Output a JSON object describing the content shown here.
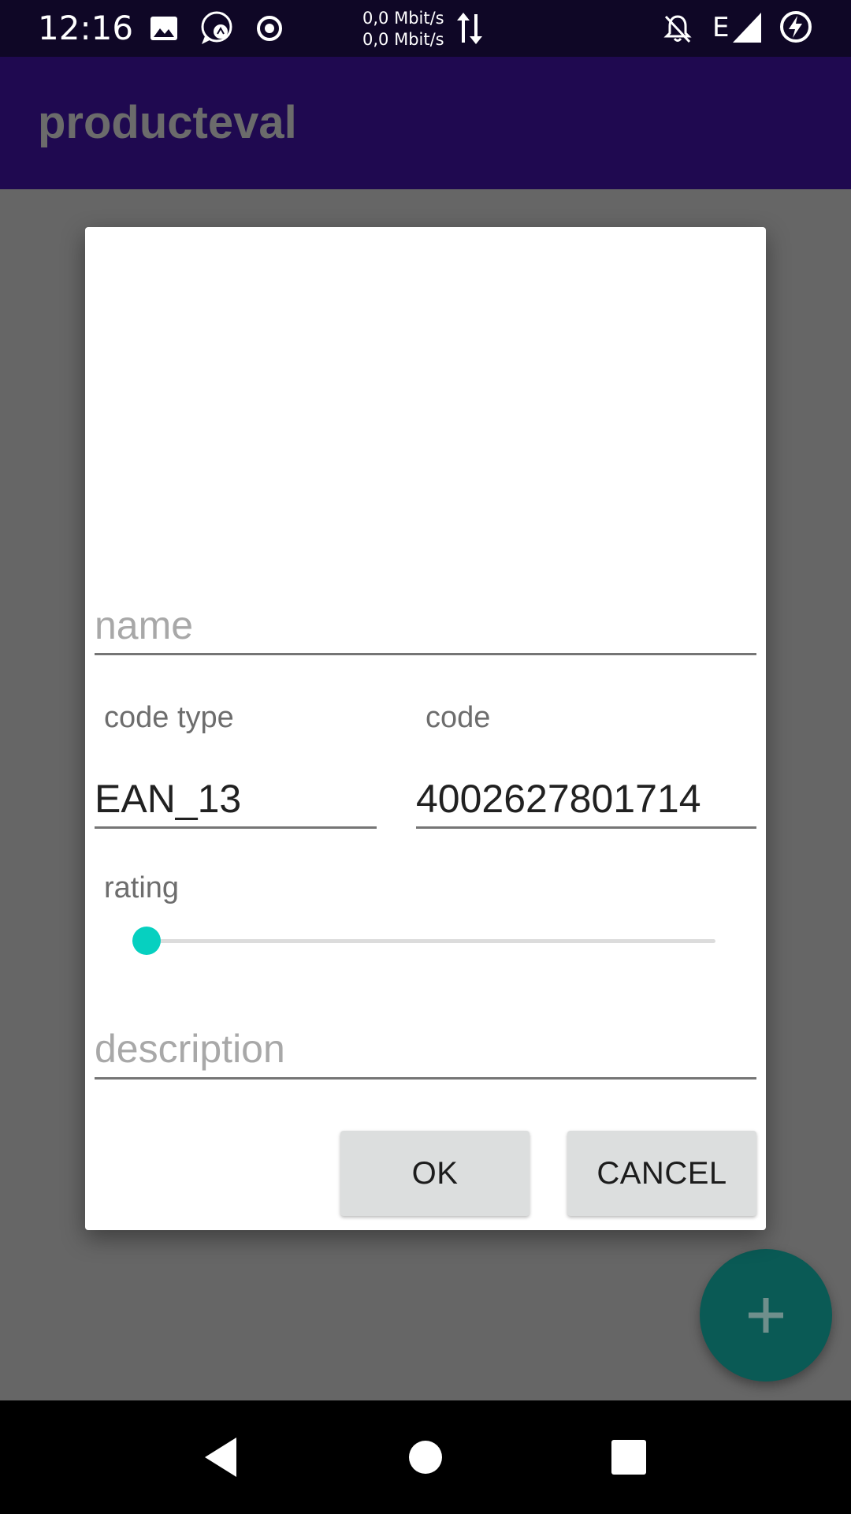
{
  "status_bar": {
    "time": "12:16",
    "net_up": "0,0 Mbit/s",
    "net_down": "0,0 Mbit/s",
    "network_type": "E",
    "icons": [
      "image-icon",
      "chat-bubble-icon",
      "record-icon",
      "data-arrows-icon",
      "notifications-off-icon",
      "signal-icon",
      "battery-charging-icon"
    ]
  },
  "app_bar": {
    "title": "producteval"
  },
  "dialog": {
    "name_placeholder": "name",
    "name_value": "",
    "code_type_label": "code type",
    "code_type_value": "EAN_13",
    "code_label": "code",
    "code_value": "4002627801714",
    "rating_label": "rating",
    "rating_value": 0,
    "description_placeholder": "description",
    "description_value": "",
    "ok_label": "OK",
    "cancel_label": "CANCEL"
  },
  "fab": {
    "icon": "plus-icon"
  },
  "nav_bar": {
    "icons": [
      "back-icon",
      "home-icon",
      "recents-icon"
    ]
  },
  "colors": {
    "status_bar": "#0f0726",
    "app_bar": "#1f0950",
    "scrim": "#666666",
    "accent": "#06d0c0",
    "fab": "#0a5a55",
    "button": "#dcdede"
  }
}
